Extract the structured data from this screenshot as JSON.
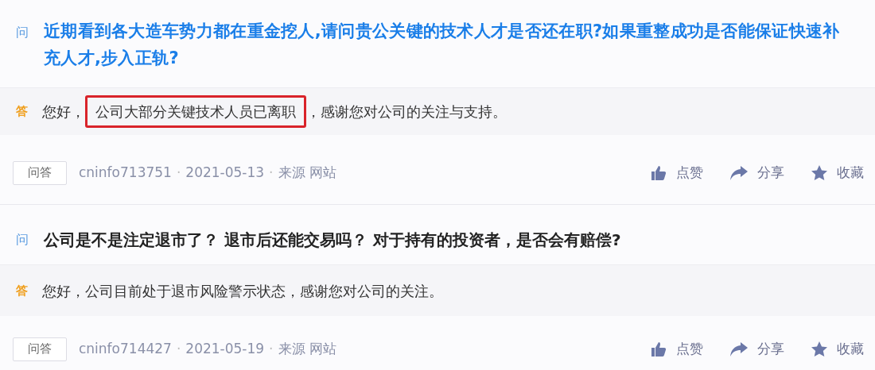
{
  "items": [
    {
      "question_mark": "问",
      "question": "近期看到各大造车势力都在重金挖人,请问贵公关键的技术人才是否还在职?如果重整成功是否能保证快速补充人才,步入正轨?",
      "color": "#1a7ee8",
      "answer_mark": "答",
      "answer": [
        {
          "text": "您好，",
          "highlighted": false
        },
        {
          "text": "公司大部分关键技术人员已离职",
          "highlighted": true
        },
        {
          "text": "，感谢您对公司的关注与支持。",
          "highlighted": false
        }
      ],
      "tag": "问答",
      "meta": [
        "cninfo713751",
        "·",
        "2021-05-13",
        "·",
        "来源 网站"
      ],
      "actions": [
        {
          "kind": "like",
          "label": "点赞"
        },
        {
          "kind": "share",
          "label": "分享"
        },
        {
          "kind": "favorite",
          "label": "收藏"
        }
      ]
    },
    {
      "question_mark": "问",
      "question": "公司是不是注定退市了？ 退市后还能交易吗？ 对于持有的投资者，是否会有赔偿?",
      "color": "#222222",
      "answer_mark": "答",
      "answer": [
        {
          "text": "您好，公司目前处于退市风险警示状态，感谢您对公司的关注。",
          "highlighted": false
        }
      ],
      "tag": "问答",
      "meta": [
        "cninfo714427",
        "·",
        "2021-05-19",
        "·",
        "来源 网站"
      ],
      "actions": [
        {
          "kind": "like",
          "label": "点赞"
        },
        {
          "kind": "share",
          "label": "分享"
        },
        {
          "kind": "favorite",
          "label": "收藏"
        }
      ]
    }
  ]
}
